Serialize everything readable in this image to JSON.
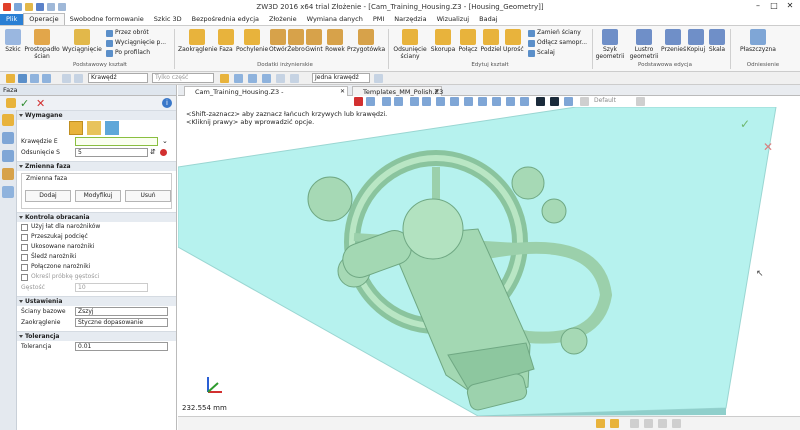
{
  "window": {
    "title": "ZW3D 2016  x64 trial        Złożenie - [Cam_Training_Housing.Z3 - [Housing_Geometry]]"
  },
  "menu": {
    "tabs": [
      "Plik",
      "Operacje",
      "Swobodne formowanie",
      "Szkic 3D",
      "Bezpośrednia edycja",
      "Złożenie",
      "Wymiana danych",
      "PMI",
      "Narzędzia",
      "Wizualizuj",
      "Badaj"
    ]
  },
  "ribbon": {
    "groups": {
      "basic": "Podstawowy kształt",
      "engineering": "Dodatki inżynierskie",
      "edit": "Edytuj kształt",
      "basic_edit": "Podstawowa edycja",
      "reference": "Odniesienie"
    },
    "buttons": {
      "sketch": "Szkic",
      "cuboid": "Prostopadło\nścian",
      "extrude": "Wyciągnięcie",
      "revolve": "Przez obrót",
      "sweep": "Wyciągnięcie p...",
      "loft": "Po profilach",
      "fillet": "Zaokrąglenie",
      "chamfer": "Faza",
      "draft": "Pochylenie",
      "hole": "Otwór",
      "rib": "Żebro",
      "thread": "Gwint",
      "groove": "Rowek",
      "lip": "Przygotówka",
      "offset_faces": "Odsunięcie\nściany",
      "shell": "Skorupa",
      "combine": "Połącz",
      "split": "Podziel",
      "simplify": "Uprość",
      "replace_face": "Zamień ściany",
      "detach": "Odłącz samopr...",
      "stitch": "Scalaj",
      "pattern": "Szyk\ngeometrii",
      "mirror": "Lustro\ngeometrii",
      "move": "Przenieś",
      "copy": "Kopiuj",
      "scale": "Skala",
      "plane": "Płaszczyzna"
    }
  },
  "toolbar2": {
    "filter": "Krawędź",
    "parts": "Tylko część",
    "chain": "Jedna krawędź"
  },
  "panel": {
    "title": "Faza",
    "sections": {
      "required": "Wymagane",
      "variable": "Zmienna faza",
      "corner": "Kontrola obracania",
      "settings": "Ustawienia",
      "tolerance": "Tolerancja"
    },
    "fields": {
      "edge_label": "Krawędzie E",
      "edge_value": "",
      "offset_label": "Odsunięcie S",
      "offset_value": "5",
      "variable_group": "Zmienna faza",
      "add": "Dodaj",
      "modify": "Modyfikuj",
      "remove": "Usuń",
      "density_label": "Gęstość",
      "density_value": "10",
      "base_faces_label": "Ściany bazowe",
      "base_faces_value": "Zszyj",
      "rounding_label": "Zaokrąglenie",
      "rounding_value": "Styczne dopasowanie",
      "tolerance_label": "Tolerancja",
      "tolerance_value": "0.01"
    },
    "checks": [
      "Użyj łat dla narożników",
      "Przeszukaj podcięć",
      "Ukosowane narożniki",
      "Śledź narożniki",
      "Połączone narożniki",
      "Określ próbkę gęstości"
    ]
  },
  "documents": {
    "tabs": [
      "Cam_Training_Housing.Z3 - [Housing_Geometry]",
      "Templates_MM_Polish.Z3"
    ],
    "render_mode": "Default"
  },
  "viewport": {
    "hint1": "<Shift-zaznacz> aby zaznacz łańcuch krzywych lub krawędzi.",
    "hint2": "<Kliknij prawy> aby wprowadzić opcje.",
    "scale": "232.554 mm",
    "colors": {
      "plate": "#b6f2ee",
      "part": "#a6d9b5",
      "accept": "#6fb86f",
      "cancel": "#d98080"
    }
  }
}
